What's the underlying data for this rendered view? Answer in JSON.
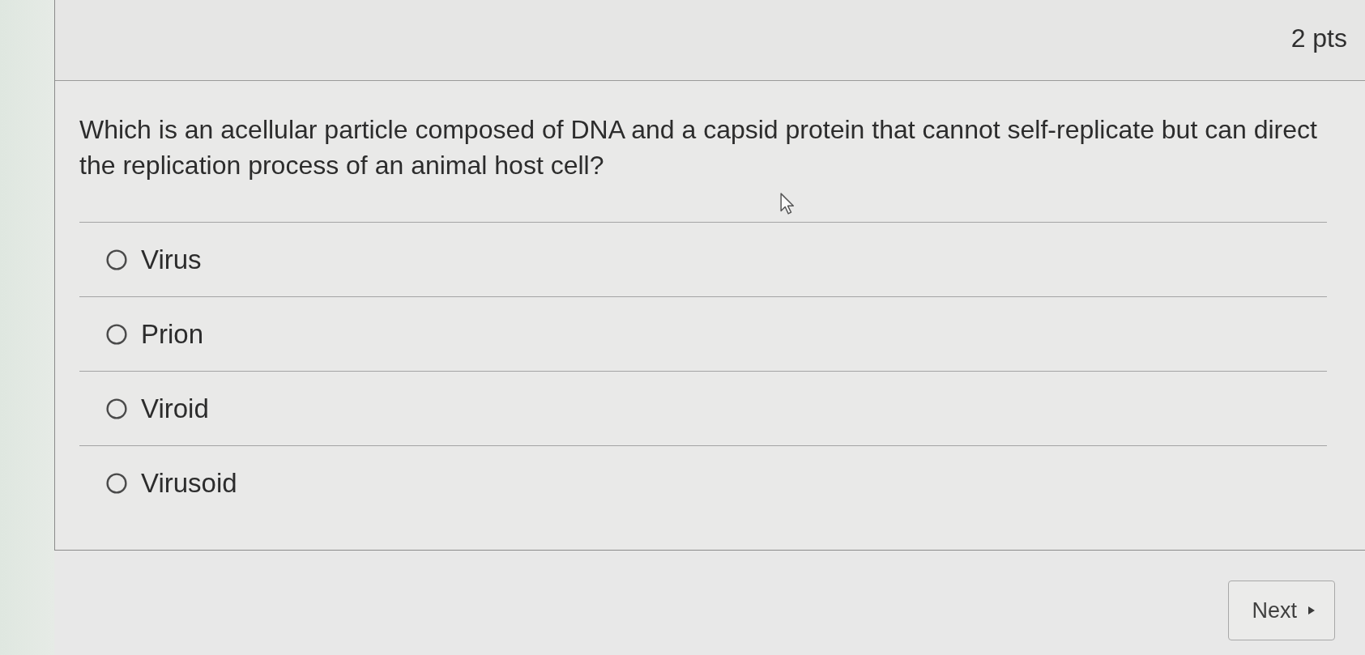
{
  "header": {
    "points": "2 pts"
  },
  "question": {
    "text": "Which is an acellular particle composed of DNA and a capsid protein that cannot self-replicate but can direct the replication process of an animal host cell?"
  },
  "options": [
    {
      "label": "Virus",
      "selected": false
    },
    {
      "label": "Prion",
      "selected": false
    },
    {
      "label": "Viroid",
      "selected": false
    },
    {
      "label": "Virusoid",
      "selected": false
    }
  ],
  "navigation": {
    "next_button": {
      "label": "Next"
    }
  }
}
